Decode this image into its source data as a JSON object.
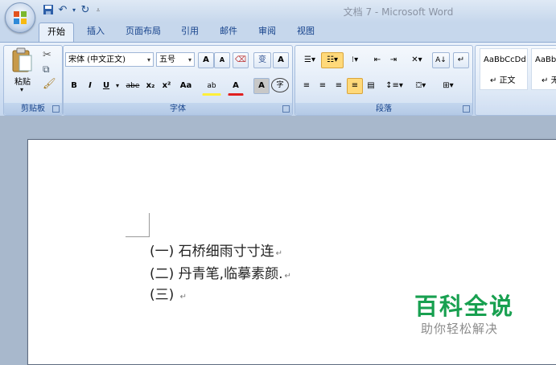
{
  "window": {
    "title": "文档 7 - Microsoft Word"
  },
  "quick_access": {
    "save_icon": "save-icon",
    "undo_icon": "undo-icon",
    "redo_icon": "redo-icon",
    "customize_icon": "dropdown-icon"
  },
  "tabs": [
    {
      "label": "开始"
    },
    {
      "label": "插入"
    },
    {
      "label": "页面布局"
    },
    {
      "label": "引用"
    },
    {
      "label": "邮件"
    },
    {
      "label": "审阅"
    },
    {
      "label": "视图"
    }
  ],
  "clipboard": {
    "paste_label": "粘贴",
    "group_label": "剪贴板"
  },
  "font": {
    "font_name": "宋体 (中文正文)",
    "font_size": "五号",
    "grow": "A",
    "shrink": "A",
    "phonetic": "变",
    "border_char": "A",
    "bold": "B",
    "italic": "I",
    "underline": "U",
    "strike": "abe",
    "subscript": "x₂",
    "superscript": "x²",
    "change_case": "Aa",
    "highlight": "ab",
    "font_color": "A",
    "shade": "A",
    "enclose": "字",
    "group_label": "字体"
  },
  "paragraph": {
    "group_label": "段落"
  },
  "styles": {
    "items": [
      {
        "preview": "AaBbCcDd",
        "name": "正文"
      },
      {
        "preview": "AaBb",
        "name": "无"
      }
    ]
  },
  "document": {
    "lines": [
      {
        "text": "(一) 石桥细雨寸寸连"
      },
      {
        "text": "(二) 丹青笔,临摹素颜."
      },
      {
        "text": "(三)"
      }
    ],
    "para_mark": "↵"
  },
  "watermark": {
    "title": "百科全说",
    "subtitle": "助你轻松解决"
  },
  "colors": {
    "ribbon": "#d4e2f4",
    "tab_text": "#15428b",
    "watermark_green": "#18a050"
  }
}
